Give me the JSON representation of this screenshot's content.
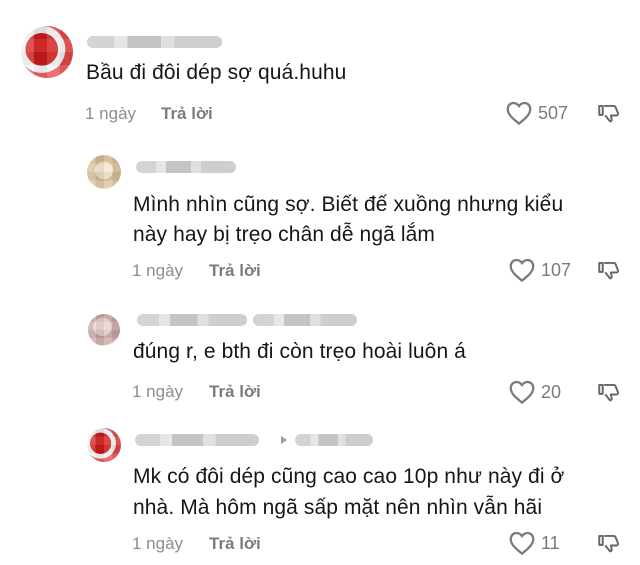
{
  "comments": [
    {
      "text": "Bầu đi đôi dép sợ quá.huhu",
      "time": "1 ngày",
      "reply_label": "Trả lời",
      "likes": "507"
    },
    {
      "text_line1": "Mình nhìn cũng sợ. Biết đế xuồng nhưng kiểu",
      "text_line2": "này hay bị trẹo chân dễ ngã lắm",
      "time": "1 ngày",
      "reply_label": "Trả lời",
      "likes": "107"
    },
    {
      "text": "đúng r, e bth đi còn trẹo hoài luôn á",
      "time": "1 ngày",
      "reply_label": "Trả lời",
      "likes": "20"
    },
    {
      "text_line1": "Mk có đôi dép cũng cao cao 10p như này đi ở",
      "text_line2": "nhà. Mà hôm ngã sấp mặt nên nhìn vẫn hãi",
      "time": "1 ngày",
      "reply_label": "Trả lời",
      "likes": "11"
    }
  ],
  "icons": {
    "like": "heart-outline-icon",
    "dislike": "thumbs-down-outline-icon"
  },
  "colors": {
    "text": "#161616",
    "meta": "#8d8d8d",
    "icon": "#7a7a7a"
  }
}
